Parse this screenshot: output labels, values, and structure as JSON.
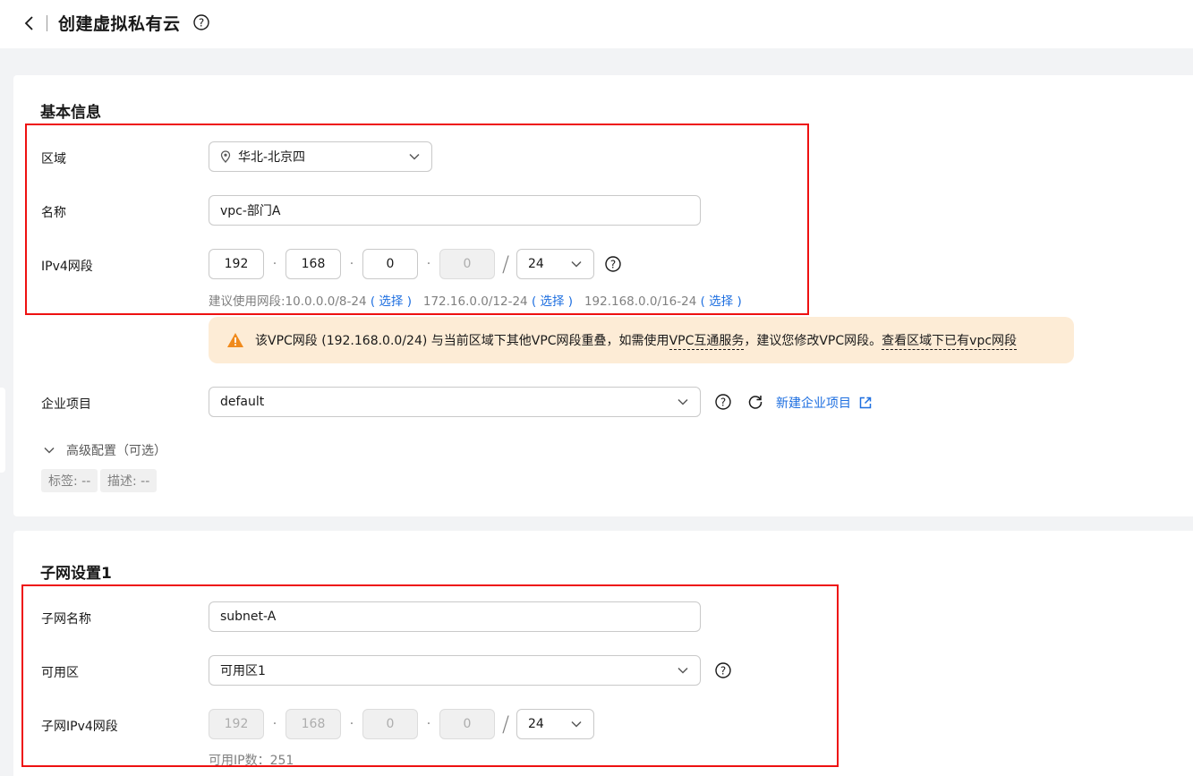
{
  "header": {
    "title": "创建虚拟私有云"
  },
  "basic": {
    "title": "基本信息",
    "region": {
      "label": "区域",
      "value": "华北-北京四"
    },
    "name": {
      "label": "名称",
      "value": "vpc-部门A"
    },
    "ipv4": {
      "label": "IPv4网段",
      "octets": [
        "192",
        "168",
        "0",
        "0"
      ],
      "mask": "24",
      "hint_prefix": "建议使用网段:10.0.0.0/8-24",
      "hint_mid1": "172.16.0.0/12-24",
      "hint_mid2": "192.168.0.0/16-24",
      "select_label": "( 选择 )"
    },
    "warning": {
      "text1": "该VPC网段 (192.168.0.0/24) 与当前区域下其他VPC网段重叠，如需使用",
      "link1": "VPC互通服务",
      "text2": "，建议您修改VPC网段。",
      "link2": "查看区域下已有vpc网段"
    },
    "enterprise": {
      "label": "企业项目",
      "value": "default",
      "create_label": "新建企业项目"
    },
    "advanced": {
      "label": "高级配置（可选）",
      "tag_label": "标签: --",
      "desc_label": "描述: --"
    }
  },
  "subnet": {
    "title": "子网设置1",
    "name": {
      "label": "子网名称",
      "value": "subnet-A"
    },
    "az": {
      "label": "可用区",
      "value": "可用区1"
    },
    "ipv4": {
      "label": "子网IPv4网段",
      "octets": [
        "192",
        "168",
        "0",
        "0"
      ],
      "mask": "24",
      "available": "可用IP数：251"
    }
  },
  "colors": {
    "link": "#1e6fe0",
    "warning_bg": "#fdecd6",
    "warning_icon": "#f08a1c",
    "highlight": "#ee1111"
  }
}
